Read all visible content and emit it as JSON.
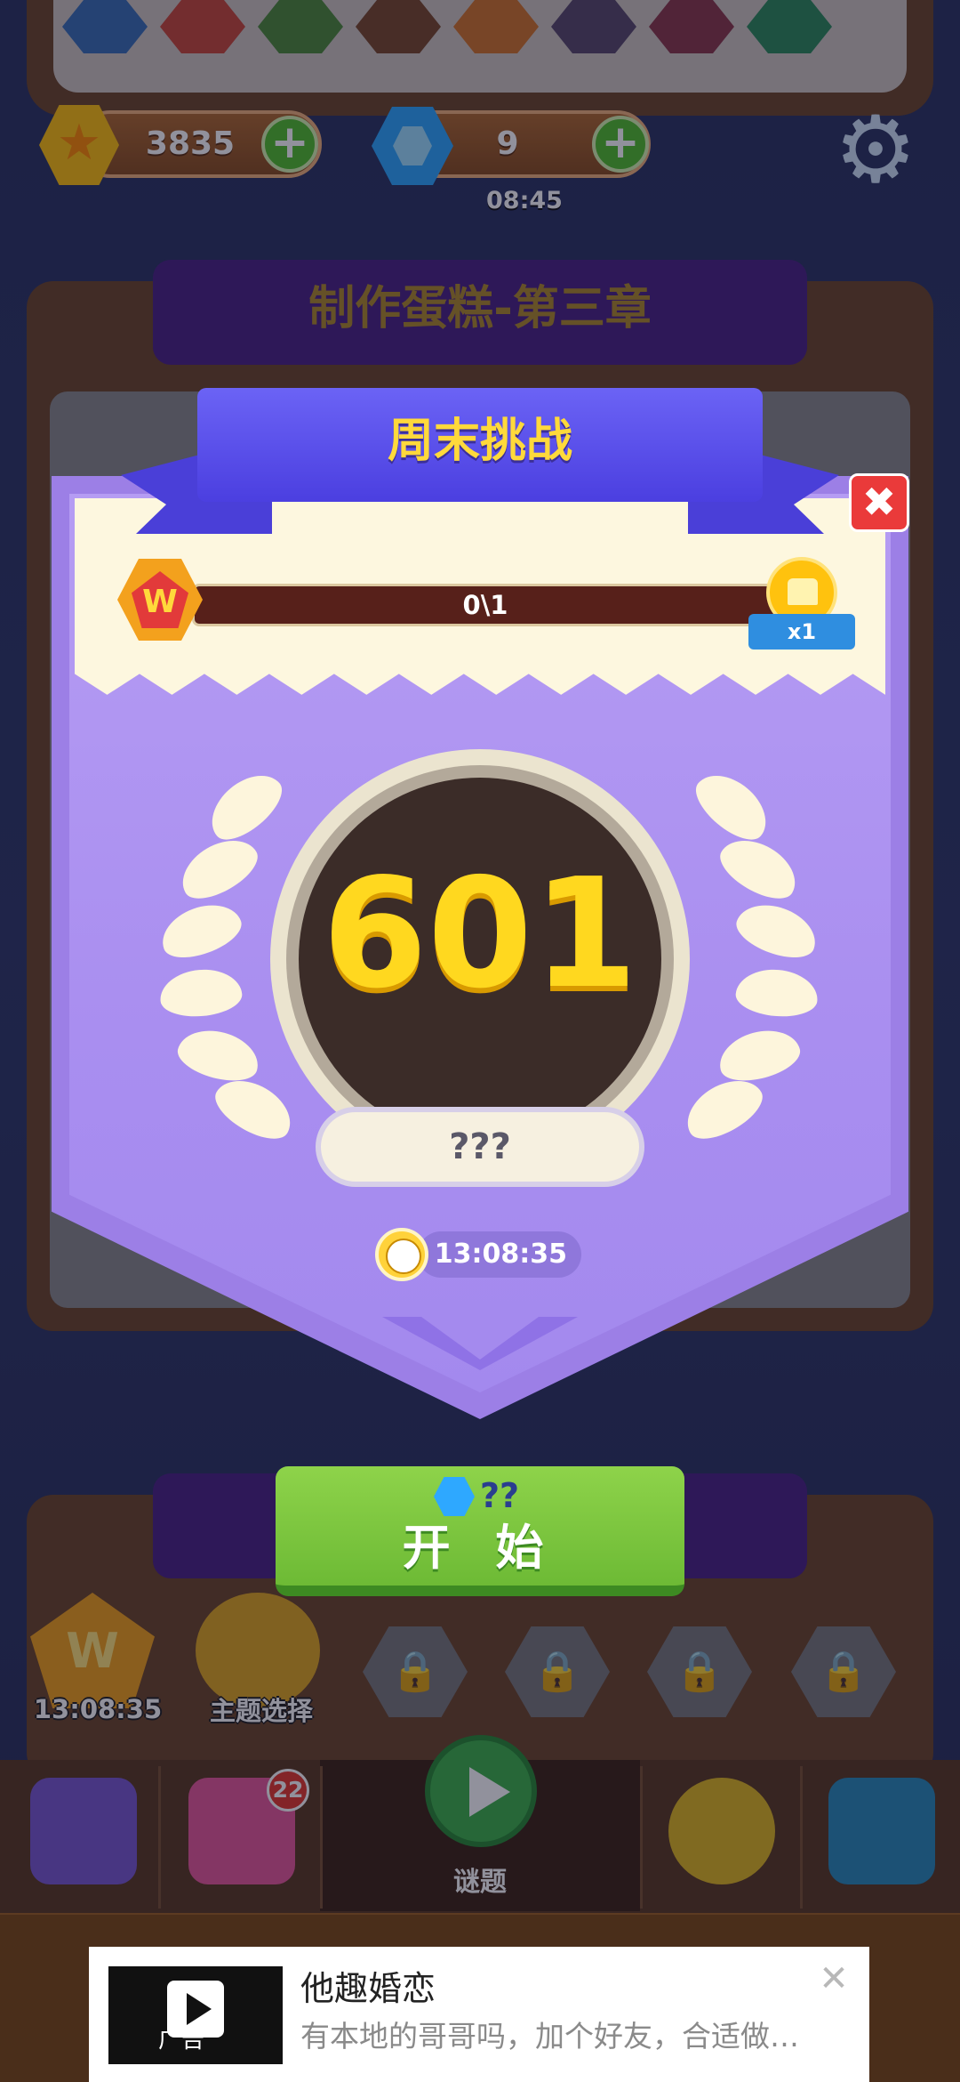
{
  "hud": {
    "coins": "3835",
    "gems": "9",
    "gem_timer": "08:45",
    "plus_symbol": "+"
  },
  "chapter": {
    "title": "制作蛋糕-第三章"
  },
  "popup": {
    "title": "周末挑战",
    "close_symbol": "✖",
    "progress_text": "0\\1",
    "progress_fraction": 0,
    "reward_multiplier": "x1",
    "level_number": "601",
    "level_name": "???",
    "countdown": "13:08:35",
    "badge_letter": "W"
  },
  "start_button": {
    "cost": "??",
    "label": "开 始"
  },
  "side": {
    "weekly_timer": "13:08:35",
    "theme_label": "主题选择"
  },
  "nav": {
    "puzzle_badge": "22",
    "center_label": "谜题"
  },
  "ad": {
    "title": "他趣婚恋",
    "description": "有本地的哥哥吗，加个好友，合适做…",
    "tag": "广告",
    "close_symbol": "✕"
  },
  "colors": {
    "accent_purple": "#a98ef0",
    "ribbon_blue": "#4b3fe0",
    "title_yellow": "#ffd93b",
    "start_green": "#6dba35"
  }
}
